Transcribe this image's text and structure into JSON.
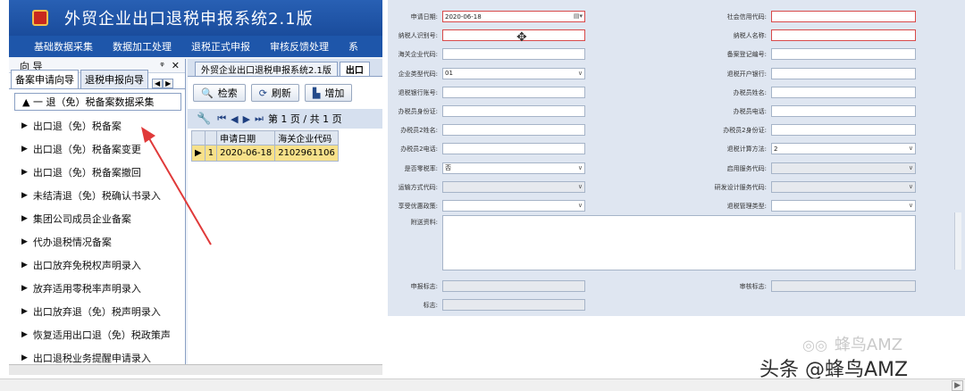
{
  "app": {
    "title": "外贸企业出口退税申报系统2.1版",
    "menu": [
      "基础数据采集",
      "数据加工处理",
      "退税正式申报",
      "审核反馈处理",
      "系"
    ]
  },
  "nav": {
    "header": "向 导",
    "pin": "ᵠ",
    "close": "✕",
    "tabs": [
      "备案申请向导",
      "退税申报向导"
    ],
    "tab_scroll": [
      "◀",
      "▶"
    ],
    "root": "▲ 一 退（免）税备案数据采集",
    "items": [
      "出口退（免）税备案",
      "出口退（免）税备案变更",
      "出口退（免）税备案撤回",
      "未结清退（免）税确认书录入",
      "集团公司成员企业备案",
      "代办退税情况备案",
      "出口放弃免税权声明录入",
      "放弃适用零税率声明录入",
      "出口放弃退（免）税声明录入",
      "恢复适用出口退（免）税政策声",
      "出口退税业务提醒申请录入"
    ]
  },
  "doc": {
    "tabs": [
      "外贸企业出口退税申报系统2.1版",
      "出口"
    ],
    "toolbar": {
      "search": "检索",
      "refresh": "刷新",
      "add": "增加"
    },
    "pager": "第 1 页 / 共 1 页",
    "grid": {
      "columns": [
        "",
        "",
        "申请日期",
        "海关企业代码"
      ],
      "rows": [
        {
          "marker": "▶",
          "num": "1",
          "date": "2020-06-18",
          "code": "2102961106"
        }
      ]
    }
  },
  "form": {
    "left": [
      {
        "label": "申请日期:",
        "value": "2020-06-18",
        "kind": "date-req"
      },
      {
        "label": "纳税人识别号:",
        "value": "",
        "kind": "req"
      },
      {
        "label": "海关企业代码:",
        "value": "",
        "kind": "text"
      },
      {
        "label": "企业类型代码:",
        "value": "01",
        "kind": "select"
      },
      {
        "label": "退税银行账号:",
        "value": "",
        "kind": "text"
      },
      {
        "label": "办税员身份证:",
        "value": "",
        "kind": "text"
      },
      {
        "label": "办税员2姓名:",
        "value": "",
        "kind": "text"
      },
      {
        "label": "办税员2电话:",
        "value": "",
        "kind": "text"
      },
      {
        "label": "是否零税率:",
        "value": "否",
        "kind": "select"
      },
      {
        "label": "运输方式代码:",
        "value": "",
        "kind": "select-dis"
      },
      {
        "label": "享受优惠政策:",
        "value": "",
        "kind": "select"
      }
    ],
    "right": [
      {
        "label": "社会信用代码:",
        "value": "",
        "kind": "req"
      },
      {
        "label": "纳税人名称:",
        "value": "",
        "kind": "req"
      },
      {
        "label": "备案登记编号:",
        "value": "",
        "kind": "text"
      },
      {
        "label": "退税开户银行:",
        "value": "",
        "kind": "text"
      },
      {
        "label": "办税员姓名:",
        "value": "",
        "kind": "text"
      },
      {
        "label": "办税员电话:",
        "value": "",
        "kind": "text"
      },
      {
        "label": "办税员2身份证:",
        "value": "",
        "kind": "text"
      },
      {
        "label": "退税计算方法:",
        "value": "2",
        "kind": "select"
      },
      {
        "label": "启用服务代码:",
        "value": "",
        "kind": "select-dis"
      },
      {
        "label": "研发设计服务代码:",
        "value": "",
        "kind": "select-dis"
      },
      {
        "label": "退税管理类型:",
        "value": "",
        "kind": "select"
      }
    ],
    "attachment_label": "附送资料:",
    "declare_flag_label": "申报标志:",
    "audit_flag_label": "审核标志:",
    "remark_label": "标志:"
  },
  "watermark": {
    "line1": "蜂鸟AMZ",
    "line2": "头条 @蜂鸟AMZ"
  },
  "colors": {
    "title_bar": "#1a4c9c",
    "form_bg": "#dfe6f1",
    "selected_row": "#f7e18a",
    "required_border": "#d84a4a",
    "arrow": "#e03a3a"
  }
}
